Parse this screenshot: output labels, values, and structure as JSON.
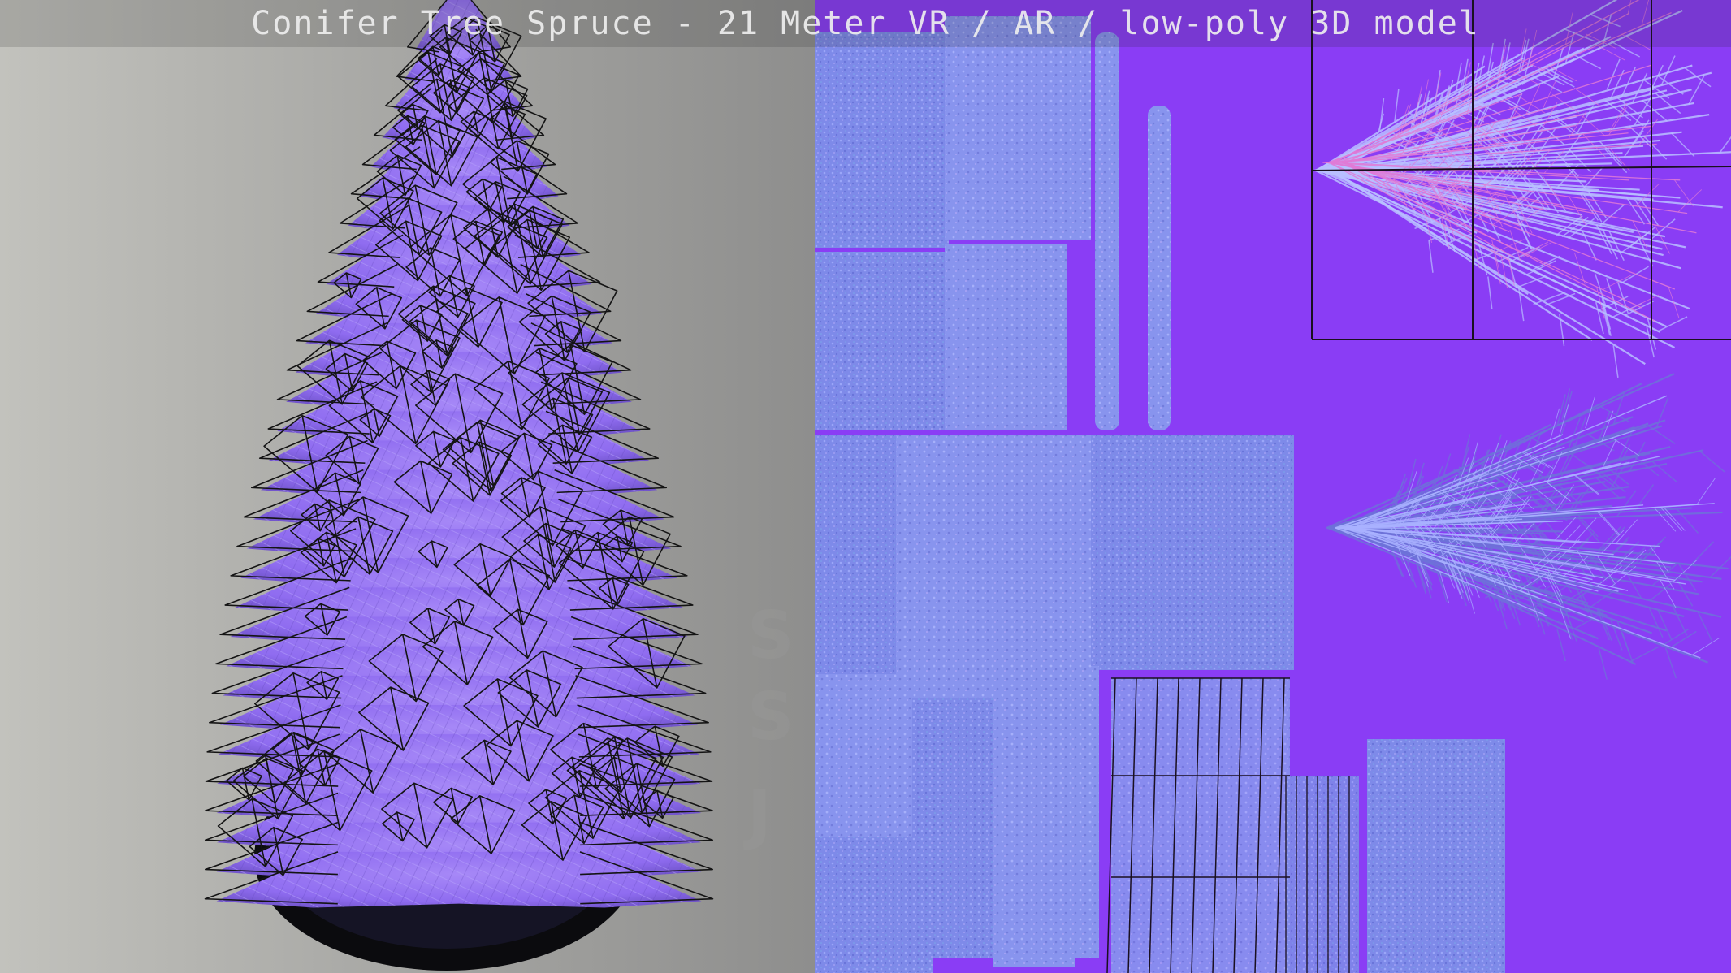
{
  "title": "Conifer Tree Spruce - 21 Meter VR / AR / low-poly 3D model",
  "scene": {
    "left_panel": "3d-viewport-wireframe-render",
    "right_panel": "normal-map-uv-layout"
  },
  "colors": {
    "viewport_light": "#c2c2bd",
    "viewport_dark": "#8e8e8d",
    "foliage": "#8f6cf0",
    "foliage_shadow": "#6e52c8",
    "wire": "#141414",
    "uv_background": "#8a3df5",
    "uv_texture": "#7d89e8",
    "uv_texture_alt": "#8f9cf2",
    "title_text": "#eeeeee"
  }
}
